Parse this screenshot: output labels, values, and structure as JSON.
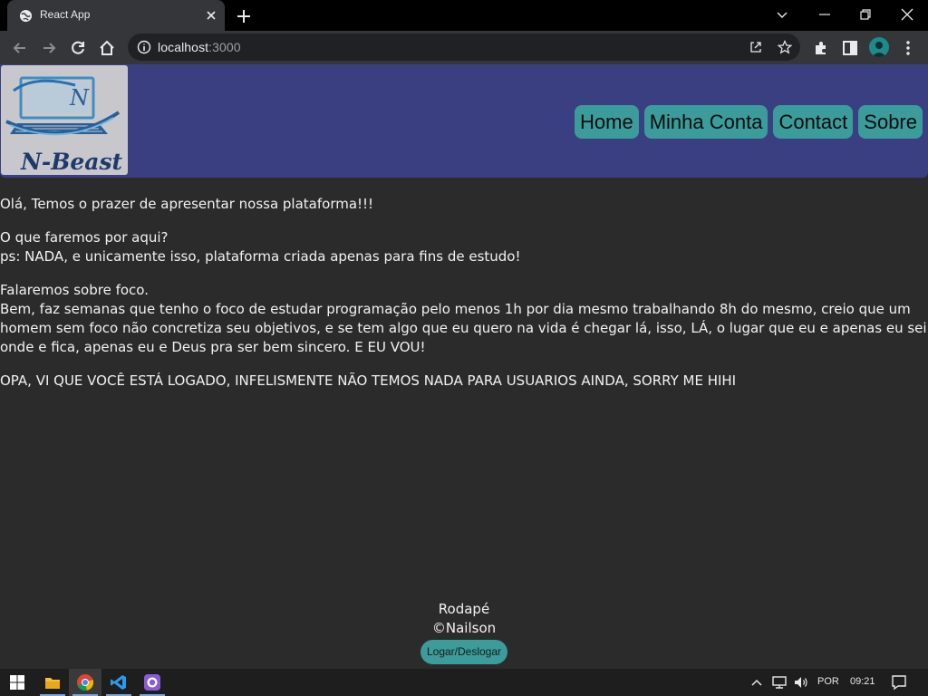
{
  "browser": {
    "tab_title": "React App",
    "url_host": "localhost",
    "url_port": ":3000"
  },
  "header": {
    "logo_text": "N-Beast",
    "logo_letter": "N",
    "nav": [
      "Home",
      "Minha Conta",
      "Contact",
      "Sobre"
    ]
  },
  "content": {
    "p1": "Olá, Temos o prazer de apresentar nossa plataforma!!!",
    "p2_line1": "O que faremos por aqui?",
    "p2_line2": "ps: NADA, e unicamente isso, plataforma criada apenas para fins de estudo!",
    "p3_line1": "Falaremos sobre foco.",
    "p3_body": "Bem, faz semanas que tenho o foco de estudar programação pelo menos 1h por dia mesmo trabalhando 8h do mesmo, creio que um homem sem foco não concretiza seu objetivos, e se tem algo que eu quero na vida é chegar lá, isso, LÁ, o lugar que eu e apenas eu sei onde e fica, apenas eu e Deus pra ser bem sincero. E EU VOU!",
    "p4": "OPA, VI QUE VOCÊ ESTÁ LOGADO, INFELISMENTE NÃO TEMOS NADA PARA USUARIOS AINDA, SORRY ME HIHI"
  },
  "footer": {
    "line1": "Rodapé",
    "line2": "©Nailson",
    "button": "Logar/Deslogar"
  },
  "taskbar": {
    "lang": "POR",
    "time": "09:21"
  },
  "colors": {
    "header_bg": "#393f80",
    "accent_button": "#3c9b9b",
    "page_bg": "#2b2b2b"
  }
}
